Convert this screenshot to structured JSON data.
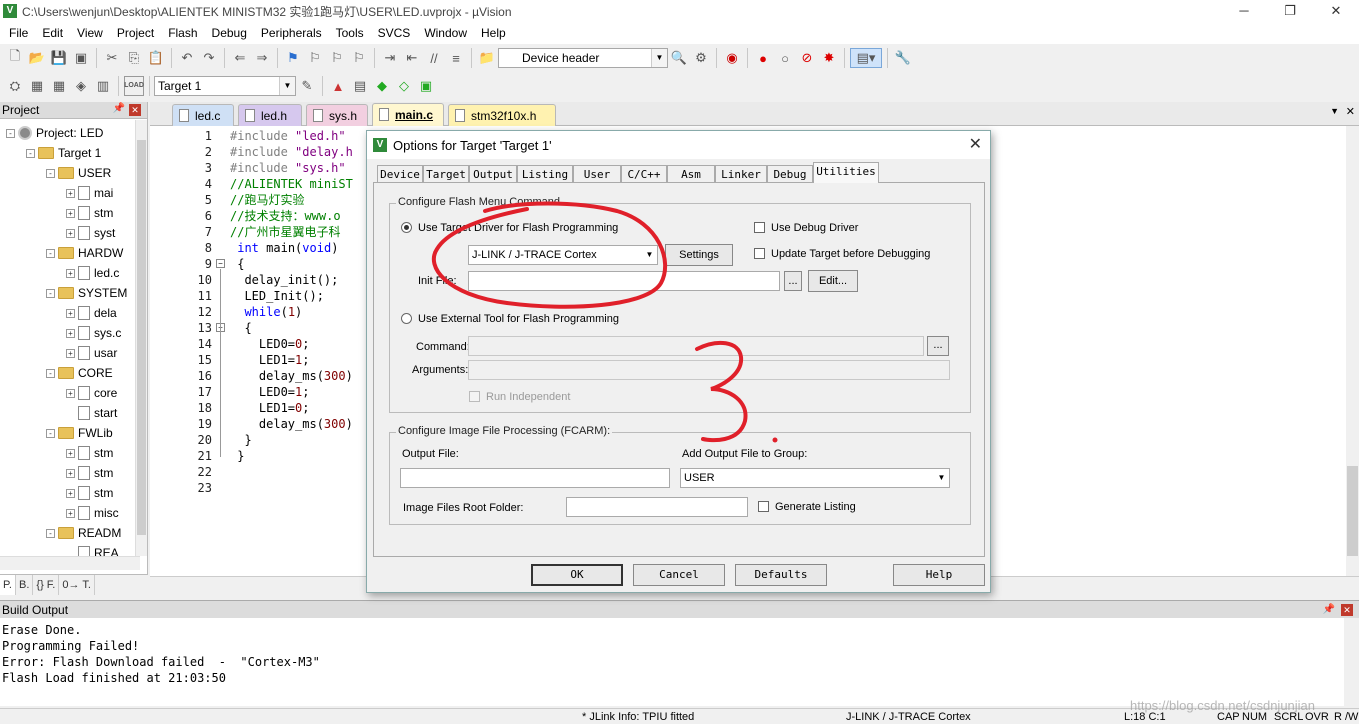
{
  "window": {
    "title": "C:\\Users\\wenjun\\Desktop\\ALIENTEK MINISTM32 实验1跑马灯\\USER\\LED.uvprojx - µVision",
    "app_icon": "V",
    "min": "─",
    "max": "❐",
    "close": "✕"
  },
  "menu": [
    "File",
    "Edit",
    "View",
    "Project",
    "Flash",
    "Debug",
    "Peripherals",
    "Tools",
    "SVCS",
    "Window",
    "Help"
  ],
  "toolbar": {
    "find_combo": "Device header",
    "target_combo": "Target 1",
    "load_label": "LOAD"
  },
  "project_panel": {
    "title": "Project",
    "tree": [
      {
        "label": "Project: LED",
        "kind": "gear",
        "exp": "-",
        "indent": 0
      },
      {
        "label": "Target 1",
        "kind": "folder",
        "exp": "-",
        "indent": 1
      },
      {
        "label": "USER",
        "kind": "folder",
        "exp": "-",
        "indent": 2
      },
      {
        "label": "mai",
        "kind": "file",
        "exp": "+",
        "indent": 3
      },
      {
        "label": "stm",
        "kind": "file",
        "exp": "+",
        "indent": 3
      },
      {
        "label": "syst",
        "kind": "file",
        "exp": "+",
        "indent": 3
      },
      {
        "label": "HARDW",
        "kind": "folder",
        "exp": "-",
        "indent": 2
      },
      {
        "label": "led.c",
        "kind": "file",
        "exp": "+",
        "indent": 3
      },
      {
        "label": "SYSTEM",
        "kind": "folder",
        "exp": "-",
        "indent": 2
      },
      {
        "label": "dela",
        "kind": "file",
        "exp": "+",
        "indent": 3
      },
      {
        "label": "sys.c",
        "kind": "file",
        "exp": "+",
        "indent": 3
      },
      {
        "label": "usar",
        "kind": "file",
        "exp": "+",
        "indent": 3
      },
      {
        "label": "CORE",
        "kind": "folder",
        "exp": "-",
        "indent": 2
      },
      {
        "label": "core",
        "kind": "file",
        "exp": "+",
        "indent": 3
      },
      {
        "label": "start",
        "kind": "file",
        "exp": "",
        "indent": 3
      },
      {
        "label": "FWLib",
        "kind": "folder",
        "exp": "-",
        "indent": 2
      },
      {
        "label": "stm",
        "kind": "file",
        "exp": "+",
        "indent": 3
      },
      {
        "label": "stm",
        "kind": "file",
        "exp": "+",
        "indent": 3
      },
      {
        "label": "stm",
        "kind": "file",
        "exp": "+",
        "indent": 3
      },
      {
        "label": "misc",
        "kind": "file",
        "exp": "+",
        "indent": 3
      },
      {
        "label": "READM",
        "kind": "folder",
        "exp": "-",
        "indent": 2
      },
      {
        "label": "REA",
        "kind": "file",
        "exp": "",
        "indent": 3
      }
    ],
    "tabs": [
      "P.",
      "B.",
      "{} F.",
      "0→ T."
    ]
  },
  "editor_tabs": [
    {
      "label": "led.c",
      "color": "#cfe0f5",
      "active": false
    },
    {
      "label": "led.h",
      "color": "#d6c8ee",
      "active": false
    },
    {
      "label": "sys.h",
      "color": "#f2cfe0",
      "active": false
    },
    {
      "label": "main.c",
      "color": "#fff7d0",
      "active": true
    },
    {
      "label": "stm32f10x.h",
      "color": "#fff2b0",
      "active": false
    }
  ],
  "code": [
    {
      "n": "1",
      "segs": [
        {
          "t": "#include ",
          "c": "c-pre"
        },
        {
          "t": "\"led.h\"",
          "c": "c-str"
        }
      ]
    },
    {
      "n": "2",
      "segs": [
        {
          "t": "#include ",
          "c": "c-pre"
        },
        {
          "t": "\"delay.h",
          "c": "c-str"
        }
      ]
    },
    {
      "n": "3",
      "segs": [
        {
          "t": "#include ",
          "c": "c-pre"
        },
        {
          "t": "\"sys.h\"",
          "c": "c-str"
        }
      ]
    },
    {
      "n": "4",
      "segs": [
        {
          "t": "//ALIENTEK miniST",
          "c": "c-com"
        }
      ]
    },
    {
      "n": "5",
      "segs": [
        {
          "t": "//跑马灯实验",
          "c": "c-com"
        }
      ]
    },
    {
      "n": "6",
      "segs": [
        {
          "t": "//技术支持：www.o",
          "c": "c-com"
        }
      ]
    },
    {
      "n": "7",
      "segs": [
        {
          "t": "//广州市星翼电子科",
          "c": "c-com"
        }
      ]
    },
    {
      "n": "8",
      "segs": [
        {
          "t": " ",
          "c": ""
        },
        {
          "t": "int",
          "c": "c-kw"
        },
        {
          "t": " main(",
          "c": ""
        },
        {
          "t": "void",
          "c": "c-kw"
        },
        {
          "t": ")",
          "c": ""
        }
      ]
    },
    {
      "n": "9",
      "segs": [
        {
          "t": " {",
          "c": ""
        }
      ]
    },
    {
      "n": "10",
      "segs": [
        {
          "t": "  delay_init();",
          "c": ""
        }
      ]
    },
    {
      "n": "11",
      "segs": [
        {
          "t": "  LED_Init();",
          "c": ""
        }
      ]
    },
    {
      "n": "12",
      "segs": [
        {
          "t": "  ",
          "c": ""
        },
        {
          "t": "while",
          "c": "c-kw"
        },
        {
          "t": "(",
          "c": ""
        },
        {
          "t": "1",
          "c": "c-num"
        },
        {
          "t": ")",
          "c": ""
        }
      ]
    },
    {
      "n": "13",
      "segs": [
        {
          "t": "  {",
          "c": ""
        }
      ]
    },
    {
      "n": "14",
      "segs": [
        {
          "t": "    LED0=",
          "c": ""
        },
        {
          "t": "0",
          "c": "c-num"
        },
        {
          "t": ";",
          "c": ""
        }
      ]
    },
    {
      "n": "15",
      "segs": [
        {
          "t": "    LED1=",
          "c": ""
        },
        {
          "t": "1",
          "c": "c-num"
        },
        {
          "t": ";",
          "c": ""
        }
      ]
    },
    {
      "n": "16",
      "segs": [
        {
          "t": "    delay_ms(",
          "c": ""
        },
        {
          "t": "300",
          "c": "c-num"
        },
        {
          "t": ")",
          "c": ""
        }
      ]
    },
    {
      "n": "17",
      "segs": [
        {
          "t": "    LED0=",
          "c": ""
        },
        {
          "t": "1",
          "c": "c-num"
        },
        {
          "t": ";",
          "c": ""
        }
      ]
    },
    {
      "n": "18",
      "segs": [
        {
          "t": "    LED1=",
          "c": ""
        },
        {
          "t": "0",
          "c": "c-num"
        },
        {
          "t": ";",
          "c": ""
        }
      ]
    },
    {
      "n": "19",
      "segs": [
        {
          "t": "    delay_ms(",
          "c": ""
        },
        {
          "t": "300",
          "c": "c-num"
        },
        {
          "t": ")",
          "c": ""
        }
      ]
    },
    {
      "n": "20",
      "segs": [
        {
          "t": "  }",
          "c": ""
        }
      ]
    },
    {
      "n": "21",
      "segs": [
        {
          "t": " }",
          "c": ""
        }
      ]
    },
    {
      "n": "22",
      "segs": []
    },
    {
      "n": "23",
      "segs": []
    }
  ],
  "dialog": {
    "title": "Options for Target 'Target 1'",
    "close": "✕",
    "tabs": [
      "Device",
      "Target",
      "Output",
      "Listing",
      "User",
      "C/C++",
      "Asm",
      "Linker",
      "Debug",
      "Utilities"
    ],
    "active_tab": "Utilities",
    "flash_group": "Configure Flash Menu Command",
    "use_target_driver": "Use Target Driver for Flash Programming",
    "driver_value": "J-LINK / J-TRACE Cortex",
    "settings": "Settings",
    "use_debug_driver": "Use Debug Driver",
    "update_target": "Update Target before Debugging",
    "init_file_label": "Init File:",
    "init_file_value": "",
    "browse": "...",
    "edit": "Edit...",
    "use_external": "Use External Tool for Flash Programming",
    "command_label": "Command:",
    "arguments_label": "Arguments:",
    "run_independent": "Run Independent",
    "image_group": "Configure Image File Processing (FCARM):",
    "output_file_label": "Output File:",
    "output_file_value": "",
    "add_output_label": "Add Output File  to Group:",
    "add_output_value": "USER",
    "root_folder_label": "Image Files Root Folder:",
    "root_folder_value": "",
    "generate_listing": "Generate Listing",
    "ok": "OK",
    "cancel": "Cancel",
    "defaults": "Defaults",
    "help": "Help",
    "annotation_digit": "3"
  },
  "build": {
    "title": "Build Output",
    "lines": [
      "Erase Done.",
      "Programming Failed!",
      "Error: Flash Download failed  -  \"Cortex-M3\"",
      "Flash Load finished at 21:03:50"
    ]
  },
  "status": {
    "info": "* JLink Info: TPIU fitted",
    "driver": "J-LINK / J-TRACE Cortex",
    "pos": "L:18 C:1",
    "caps": "CAP",
    "num": "NUM",
    "scrl": "SCRL",
    "ovr": "OVR",
    "rw": "R /W"
  },
  "watermark": "https://blog.csdn.net/csdnjunjian"
}
